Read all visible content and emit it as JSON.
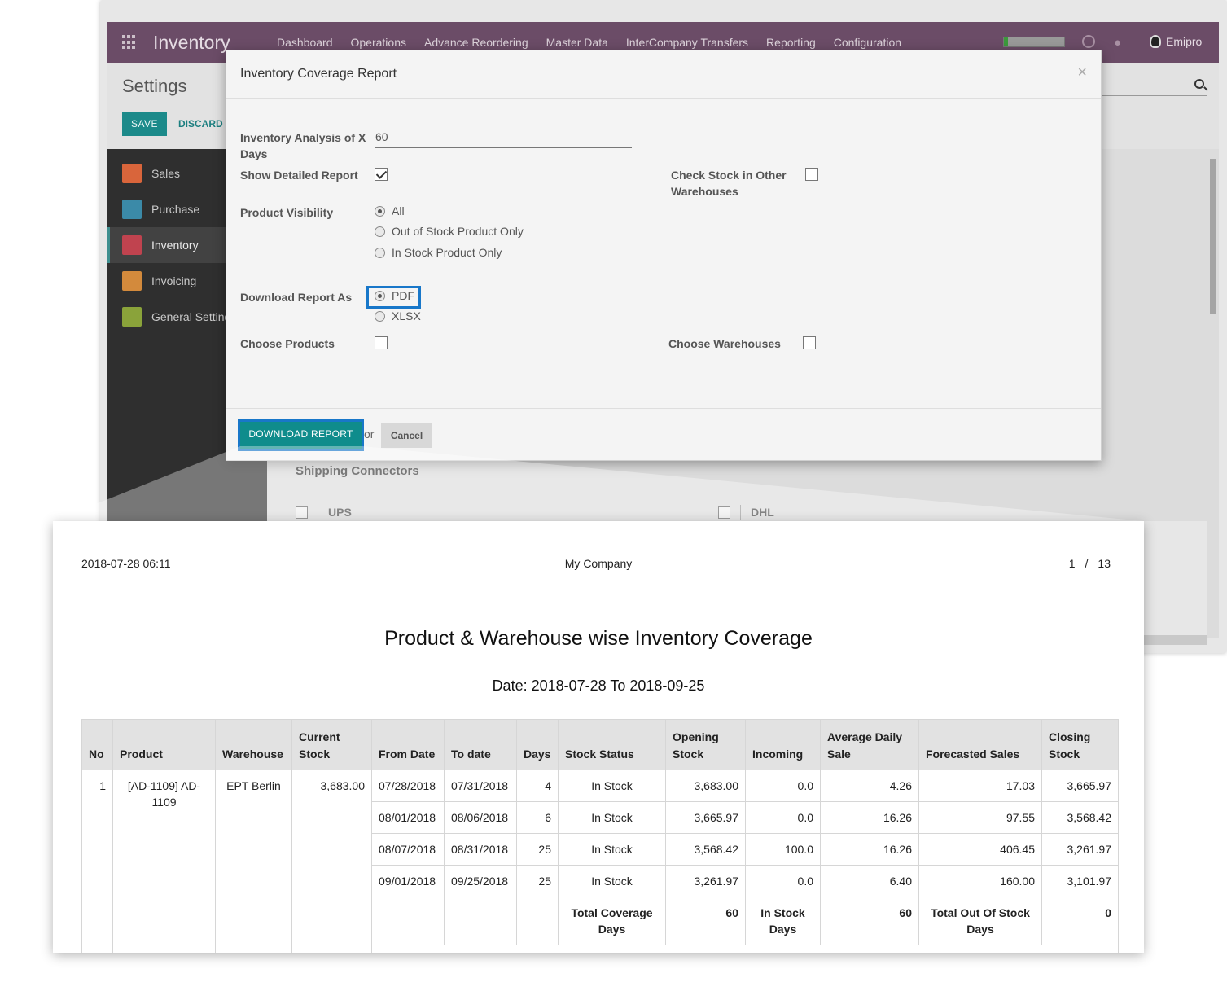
{
  "navbar": {
    "brand": "Inventory",
    "menu": [
      "Dashboard",
      "Operations",
      "Advance Reordering",
      "Master Data",
      "InterCompany Transfers",
      "Reporting",
      "Configuration"
    ],
    "user": "Emipro"
  },
  "control_panel": {
    "title": "Settings",
    "save_label": "SAVE",
    "discard_label": "DISCARD"
  },
  "sidebar": {
    "items": [
      {
        "label": "Sales",
        "color": "#d9653b"
      },
      {
        "label": "Purchase",
        "color": "#3b8aa8"
      },
      {
        "label": "Inventory",
        "color": "#c0434f"
      },
      {
        "label": "Invoicing",
        "color": "#d38a3c"
      },
      {
        "label": "General Settings",
        "color": "#8aa33a"
      }
    ]
  },
  "background_content": {
    "shipping_title": "Shipping Connectors",
    "options": [
      "UPS",
      "DHL"
    ]
  },
  "modal": {
    "title": "Inventory Coverage Report",
    "close_glyph": "×",
    "days_label": "Inventory Analysis of X Days",
    "days_value": "60",
    "detailed_label": "Show Detailed Report",
    "detailed_checked": true,
    "other_wh_label": "Check Stock in Other Warehouses",
    "other_wh_checked": false,
    "visibility_label": "Product Visibility",
    "visibility_options": [
      "All",
      "Out of Stock Product Only",
      "In Stock Product Only"
    ],
    "visibility_selected": "All",
    "download_as_label": "Download Report As",
    "download_options": [
      "PDF",
      "XLSX"
    ],
    "download_selected": "PDF",
    "choose_products_label": "Choose Products",
    "choose_warehouses_label": "Choose Warehouses",
    "download_button": "DOWNLOAD REPORT",
    "or_text": "or",
    "cancel_button": "Cancel"
  },
  "report": {
    "timestamp": "2018-07-28 06:11",
    "company": "My Company",
    "page_current": "1",
    "page_sep": "/",
    "page_total": "13",
    "title": "Product & Warehouse wise Inventory Coverage",
    "date_range": "Date: 2018-07-28 To 2018-09-25",
    "columns": [
      "No",
      "Product",
      "Warehouse",
      "Current Stock",
      "From Date",
      "To date",
      "Days",
      "Stock Status",
      "Opening Stock",
      "Incoming",
      "Average Daily Sale",
      "Forecasted Sales",
      "Closing Stock"
    ],
    "row": {
      "no": "1",
      "product": "[AD-1109] AD-1109",
      "warehouse": "EPT Berlin",
      "current_stock": "3,683.00",
      "periods": [
        {
          "from": "07/28/2018",
          "to": "07/31/2018",
          "days": "4",
          "status": "In Stock",
          "opening": "3,683.00",
          "incoming": "0.0",
          "avg_sale": "4.26",
          "forecast": "17.03",
          "closing": "3,665.97"
        },
        {
          "from": "08/01/2018",
          "to": "08/06/2018",
          "days": "6",
          "status": "In Stock",
          "opening": "3,665.97",
          "incoming": "0.0",
          "avg_sale": "16.26",
          "forecast": "97.55",
          "closing": "3,568.42"
        },
        {
          "from": "08/07/2018",
          "to": "08/31/2018",
          "days": "25",
          "status": "In Stock",
          "opening": "3,568.42",
          "incoming": "100.0",
          "avg_sale": "16.26",
          "forecast": "406.45",
          "closing": "3,261.97"
        },
        {
          "from": "09/01/2018",
          "to": "09/25/2018",
          "days": "25",
          "status": "In Stock",
          "opening": "3,261.97",
          "incoming": "0.0",
          "avg_sale": "6.40",
          "forecast": "160.00",
          "closing": "3,101.97"
        }
      ],
      "totals": {
        "coverage_label": "Total Coverage Days",
        "coverage_value": "60",
        "instock_label": "In Stock Days",
        "instock_value": "60",
        "outstock_label": "Total Out Of Stock Days",
        "outstock_value": "0"
      }
    }
  }
}
